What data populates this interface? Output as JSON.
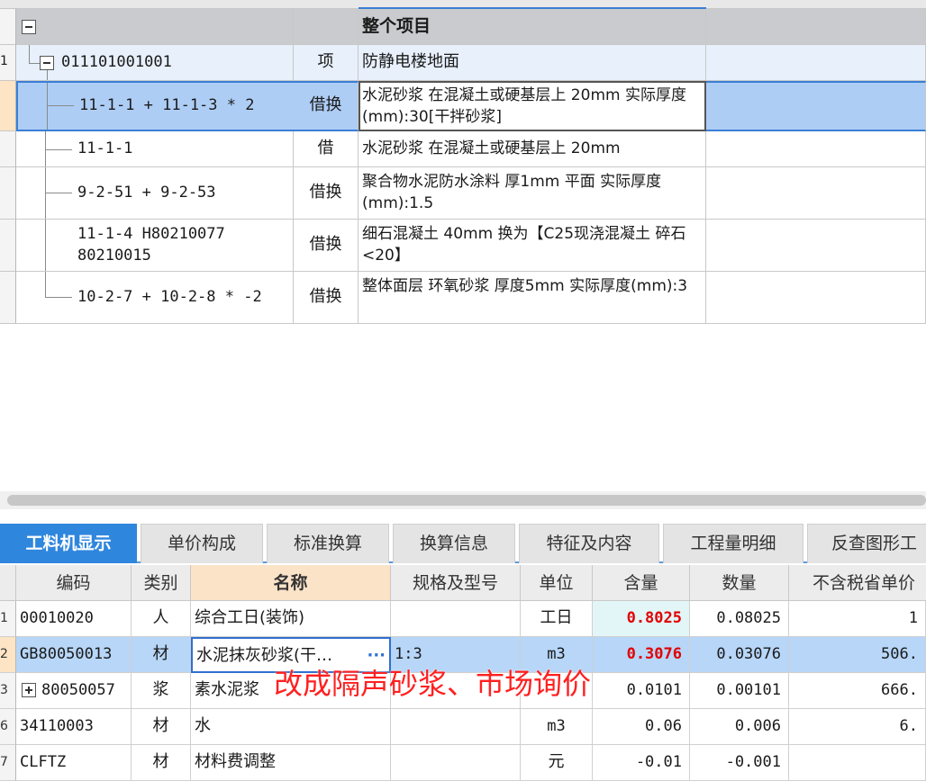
{
  "tree": {
    "header": {
      "name": "整个项目"
    },
    "rows": [
      {
        "code": "011101001001",
        "type": "项",
        "name": "防静电楼地面"
      },
      {
        "code": "11-1-1 + 11-1-3 * 2",
        "type": "借换",
        "name": "水泥砂浆 在混凝土或硬基层上 20mm  实际厚度(mm):30[干拌砂浆]"
      },
      {
        "code": "11-1-1",
        "type": "借",
        "name": "水泥砂浆 在混凝土或硬基层上 20mm"
      },
      {
        "code": "9-2-51 + 9-2-53",
        "type": "借换",
        "name": "聚合物水泥防水涂料 厚1mm 平面  实际厚度(mm):1.5"
      },
      {
        "code": "11-1-4 H80210077 80210015",
        "type": "借换",
        "name": "细石混凝土 40mm  换为【C25现浇混凝土 碎石<20】"
      },
      {
        "code": "10-2-7 + 10-2-8 * -2",
        "type": "借换",
        "name": "整体面层 环氧砂浆 厚度5mm  实际厚度(mm):3"
      }
    ]
  },
  "tabs": [
    "工料机显示",
    "单价构成",
    "标准换算",
    "换算信息",
    "特征及内容",
    "工程量明细",
    "反查图形工"
  ],
  "table": {
    "columns": [
      "编码",
      "类别",
      "名称",
      "规格及型号",
      "单位",
      "含量",
      "数量",
      "不含税省单价"
    ],
    "rows": [
      {
        "num": "1",
        "code": "00010020",
        "type": "人",
        "name": "综合工日(装饰)",
        "spec": "",
        "unit": "工日",
        "content": "0.8025",
        "qty": "0.08025",
        "price": "1"
      },
      {
        "num": "2",
        "code": "GB80050013",
        "type": "材",
        "name": "水泥抹灰砂浆(干…",
        "spec": "1:3",
        "unit": "m3",
        "content": "0.3076",
        "qty": "0.03076",
        "price": "506."
      },
      {
        "num": "3",
        "code": "80050057",
        "type": "浆",
        "name": "素水泥浆",
        "spec": "",
        "unit": "",
        "content": "0.0101",
        "qty": "0.00101",
        "price": "666."
      },
      {
        "num": "6",
        "code": "34110003",
        "type": "材",
        "name": "水",
        "spec": "",
        "unit": "m3",
        "content": "0.06",
        "qty": "0.006",
        "price": "6."
      },
      {
        "num": "7",
        "code": "CLFTZ",
        "type": "材",
        "name": "材料费调整",
        "spec": "",
        "unit": "元",
        "content": "-0.01",
        "qty": "-0.001",
        "price": ""
      }
    ],
    "ellipsis": "···"
  },
  "annotation": "改成隔声砂浆、市场询价",
  "colors": {
    "selected_row": "#aecdf5",
    "active_tab": "#2f86dd",
    "annotation": "#ff2020",
    "highlight_value": "#e00000"
  }
}
